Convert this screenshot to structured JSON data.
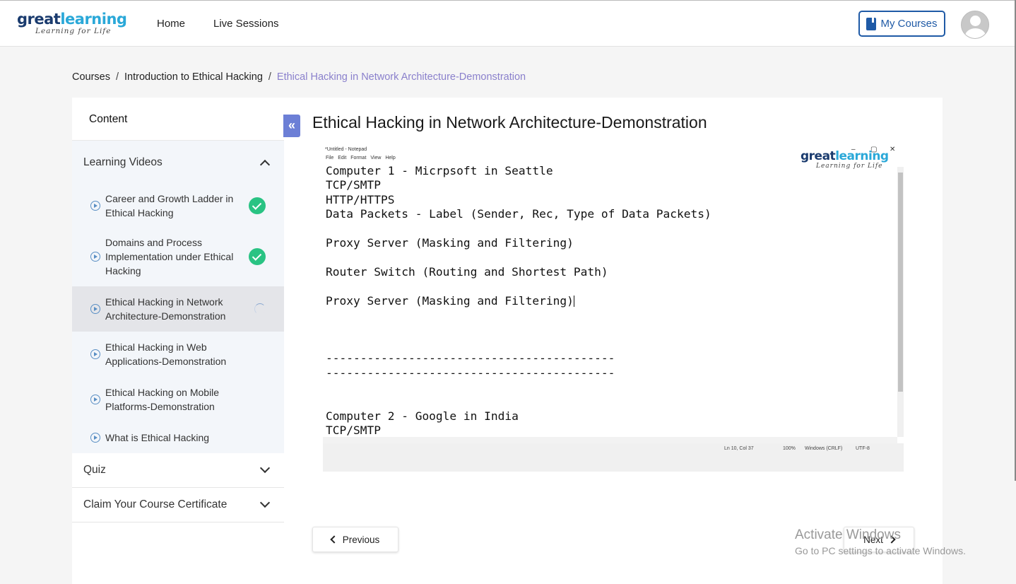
{
  "header": {
    "logo": {
      "brand_part1": "great",
      "brand_part2": "learning",
      "tagline": "Learning for Life"
    },
    "nav": [
      "Home",
      "Live Sessions"
    ],
    "my_courses_label": "My Courses",
    "avatar_icon": "user-avatar-icon"
  },
  "breadcrumb": {
    "items": [
      "Courses",
      "Introduction to Ethical Hacking"
    ],
    "current": "Ethical Hacking in Network Architecture-Demonstration",
    "separator": "/"
  },
  "sidebar": {
    "content_label": "Content",
    "collapse_icon": "«",
    "sections": [
      {
        "label": "Learning Videos",
        "expanded": true
      },
      {
        "label": "Quiz",
        "expanded": false
      },
      {
        "label": "Claim Your Course Certificate",
        "expanded": false
      }
    ],
    "videos": [
      {
        "label": "Career and Growth Ladder in Ethical Hacking",
        "status": "completed"
      },
      {
        "label": "Domains and Process Implementation under Ethical Hacking",
        "status": "completed"
      },
      {
        "label": "Ethical Hacking in Network Architecture-Demonstration",
        "status": "in-progress"
      },
      {
        "label": "Ethical Hacking in Web Applications-Demonstration",
        "status": "not-started"
      },
      {
        "label": "Ethical Hacking on Mobile Platforms-Demonstration",
        "status": "not-started"
      },
      {
        "label": "What is Ethical Hacking",
        "status": "not-started"
      }
    ]
  },
  "main": {
    "title": "Ethical Hacking in Network Architecture-Demonstration",
    "video": {
      "window_title": "*Untitled - Notepad",
      "menu": "File Edit Format View Help",
      "window_controls": {
        "minimize": "–",
        "maximize": "▢",
        "close": "✕"
      },
      "watermark": {
        "brand_part1": "great",
        "brand_part2": "learning",
        "tagline": "Learning for Life"
      },
      "lines": [
        "Computer 1 - Micrpsoft in Seattle",
        "TCP/SMTP",
        "HTTP/HTTPS",
        "Data Packets - Label (Sender, Rec, Type of Data Packets)",
        "",
        "Proxy Server (Masking and Filtering)",
        "",
        "Router Switch (Routing and Shortest Path)",
        "",
        "Proxy Server (Masking and Filtering)",
        "",
        "",
        "",
        "------------------------------------------",
        "------------------------------------------",
        "",
        "",
        "Computer 2 - Google in India",
        "TCP/SMTP"
      ],
      "status_bar": {
        "position": "Ln 10, Col 37",
        "zoom": "100%",
        "line_ending": "Windows (CRLF)",
        "encoding": "UTF-8"
      }
    },
    "previous_label": "Previous",
    "next_label": "Next"
  },
  "os_overlay": {
    "line1": "Activate Windows",
    "line2": "Go to PC settings to activate Windows."
  },
  "colors": {
    "accent": "#1f5aa6",
    "breadcrumb_current": "#8a80cc",
    "check": "#29c383",
    "collapse": "#6c7fd6"
  }
}
